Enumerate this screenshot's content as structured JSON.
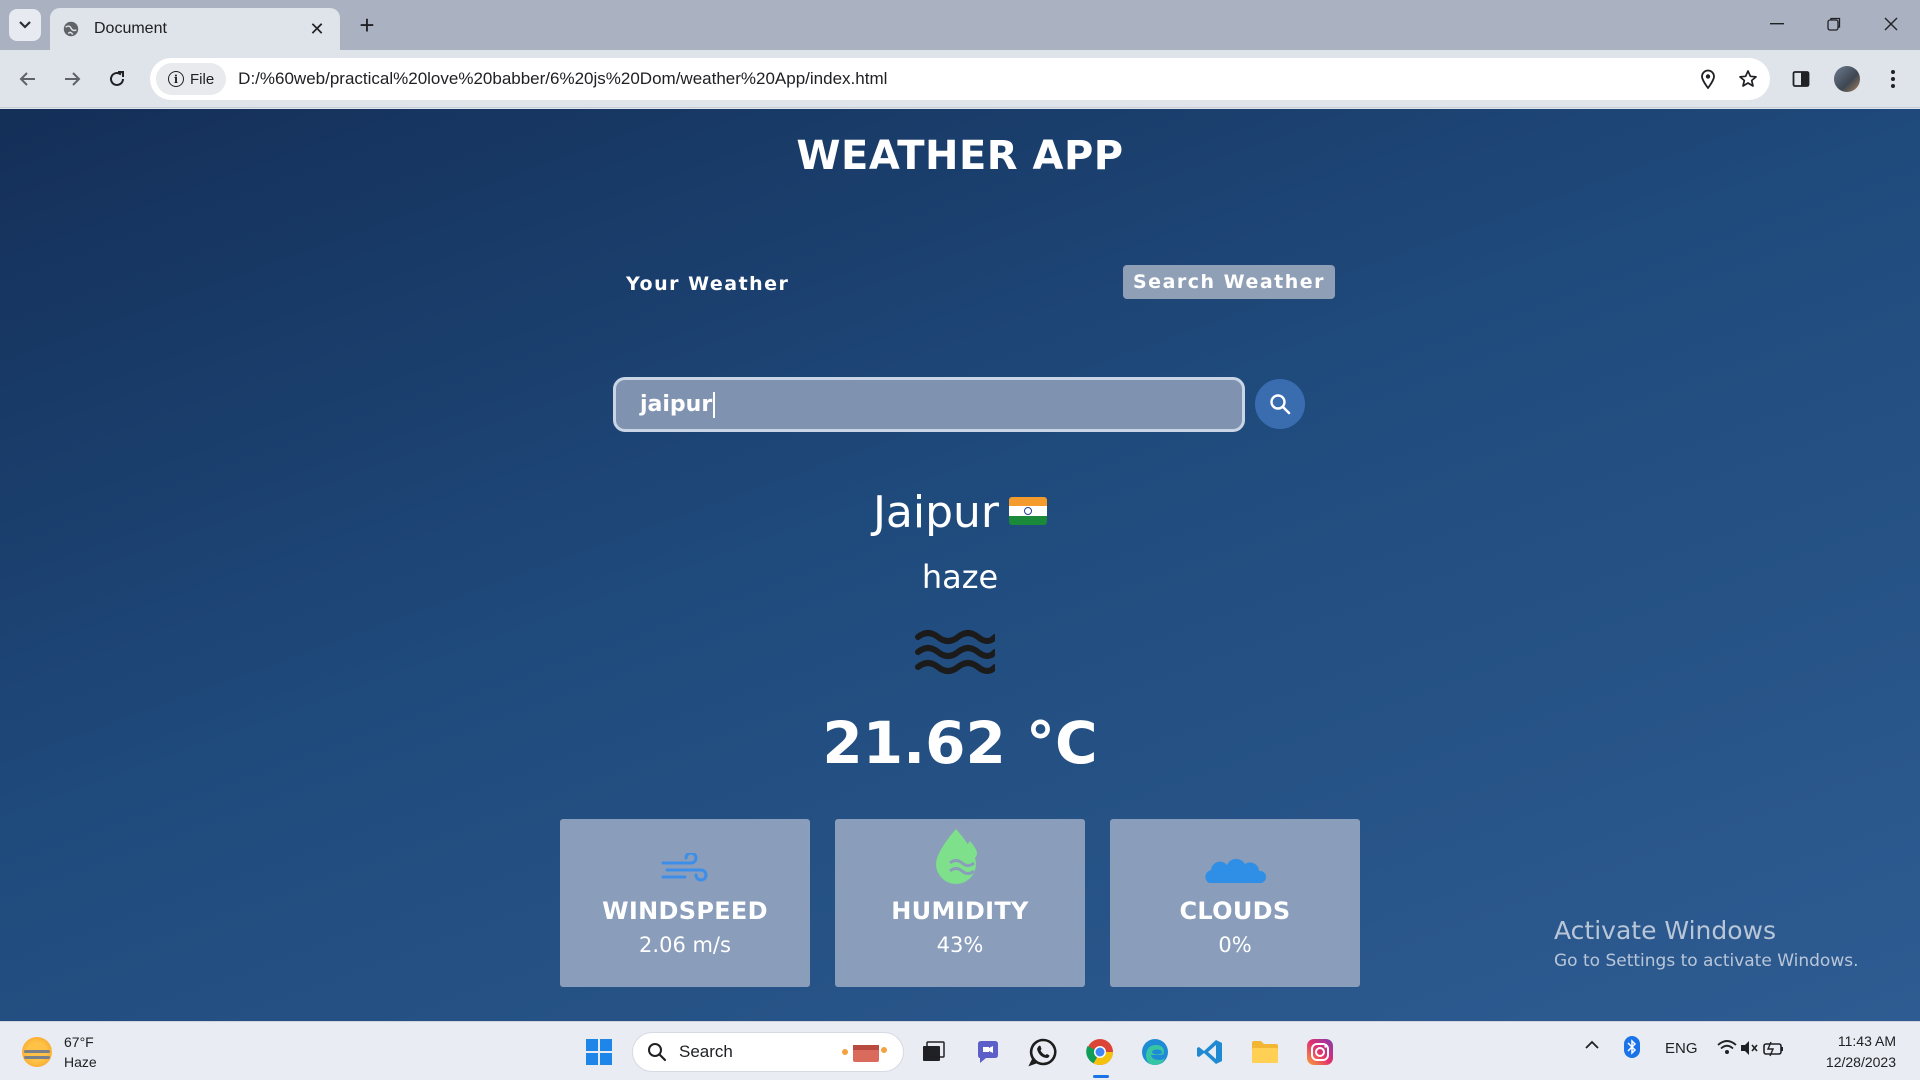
{
  "browser": {
    "tab_title": "Document",
    "url_chip": "File",
    "url": "D:/%60web/practical%20love%20babber/6%20js%20Dom/weather%20App/index.html"
  },
  "app": {
    "title": "WEATHER APP",
    "tab_your_weather": "Your Weather",
    "tab_search_weather": "Search Weather",
    "search_value": "jaipur",
    "city": "Jaipur",
    "description": "haze",
    "temperature": "21.62 °C",
    "weather_icon": "haze-icon",
    "cards": [
      {
        "label": "WINDSPEED",
        "value": "2.06 m/s",
        "icon": "wind-icon"
      },
      {
        "label": "HUMIDITY",
        "value": "43%",
        "icon": "humidity-icon"
      },
      {
        "label": "CLOUDS",
        "value": "0%",
        "icon": "cloud-icon"
      }
    ]
  },
  "watermark": {
    "line1": "Activate Windows",
    "line2": "Go to Settings to activate Windows."
  },
  "taskbar": {
    "weather_temp": "67°F",
    "weather_desc": "Haze",
    "search_label": "Search",
    "language": "ENG",
    "time": "11:43 AM",
    "date": "12/28/2023"
  },
  "colors": {
    "page_gradient_start": "#142f58",
    "page_gradient_end": "#2e5c92",
    "card_bg": "#8a9dbb",
    "active_tab_bg": "#8f9fb6",
    "search_button": "#3a6db0"
  }
}
